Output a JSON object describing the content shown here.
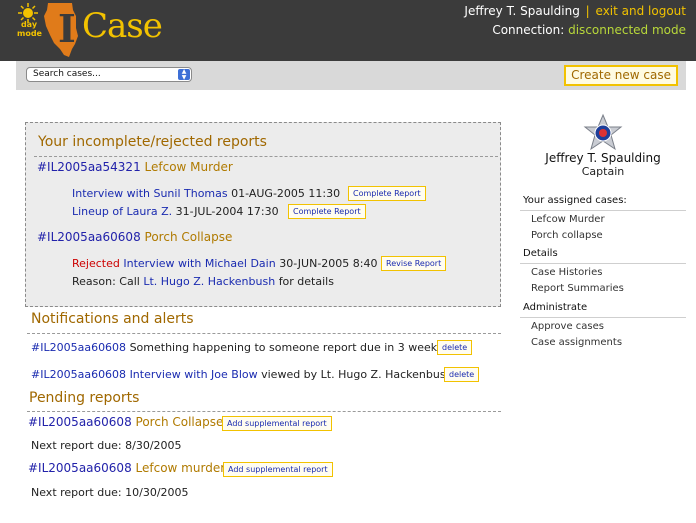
{
  "header": {
    "mode_label_line1": "day",
    "mode_label_line2": "mode",
    "logo_i": "I",
    "logo_case": "Case",
    "user_name": "Jeffrey T. Spaulding",
    "separator": "|",
    "logout_label": "exit and logout",
    "connection_label": "Connection:",
    "connection_status": "disconnected mode",
    "colors": {
      "background": "#3b3b3b",
      "accent": "#f2c200",
      "status": "#b8d83a"
    }
  },
  "search": {
    "selected": "Search cases..."
  },
  "toolbar": {
    "create_label": "Create new case"
  },
  "incomplete": {
    "title": "Your incomplete/rejected reports",
    "cases": [
      {
        "id": "#IL2005aa54321",
        "name": "Lefcow Murder",
        "items": [
          {
            "title": "Interview with Sunil Thomas",
            "date": "01-AUG-2005 11:30",
            "button": "Complete Report"
          },
          {
            "title": "Lineup of Laura Z.",
            "date": "31-JUL-2004 17:30",
            "button": "Complete Report"
          }
        ]
      },
      {
        "id": "#IL2005aa60608",
        "name": "Porch Collapse",
        "items": [
          {
            "status": "Rejected",
            "title": "Interview with Michael Dain",
            "date": "30-JUN-2005 8:40",
            "button": "Revise Report"
          }
        ],
        "reason_prefix": "Reason: Call",
        "reason_person": "Lt. Hugo Z. Hackenbush",
        "reason_suffix": "for details"
      }
    ]
  },
  "notifications": {
    "title": "Notifications and alerts",
    "items": [
      {
        "case_id": "#IL2005aa60608",
        "text": "Something happening to someone report due in 3 weeks",
        "button": "delete"
      },
      {
        "case_id": "#IL2005aa60608",
        "link": "Interview with Joe Blow",
        "text": "viewed by Lt. Hugo Z. Hackenbush",
        "button": "delete"
      }
    ]
  },
  "pending": {
    "title": "Pending reports",
    "items": [
      {
        "case_id": "#IL2005aa60608",
        "name": "Porch Collapse",
        "button": "Add supplemental report",
        "due": "Next report due: 8/30/2005"
      },
      {
        "case_id": "#IL2005aa60608",
        "name": "Lefcow murder",
        "button": "Add supplemental report",
        "due": "Next report due: 10/30/2005"
      }
    ]
  },
  "profile": {
    "name": "Jeffrey T. Spaulding",
    "rank": "Captain",
    "badge_icon": "chicago-police-star-icon",
    "assigned_heading": "Your assigned cases:",
    "assigned": [
      "Lefcow Murder",
      "Porch collapse"
    ],
    "details_heading": "Details",
    "details": [
      "Case Histories",
      "Report Summaries"
    ],
    "admin_heading": "Administrate",
    "admin": [
      "Approve cases",
      "Case assignments"
    ]
  }
}
